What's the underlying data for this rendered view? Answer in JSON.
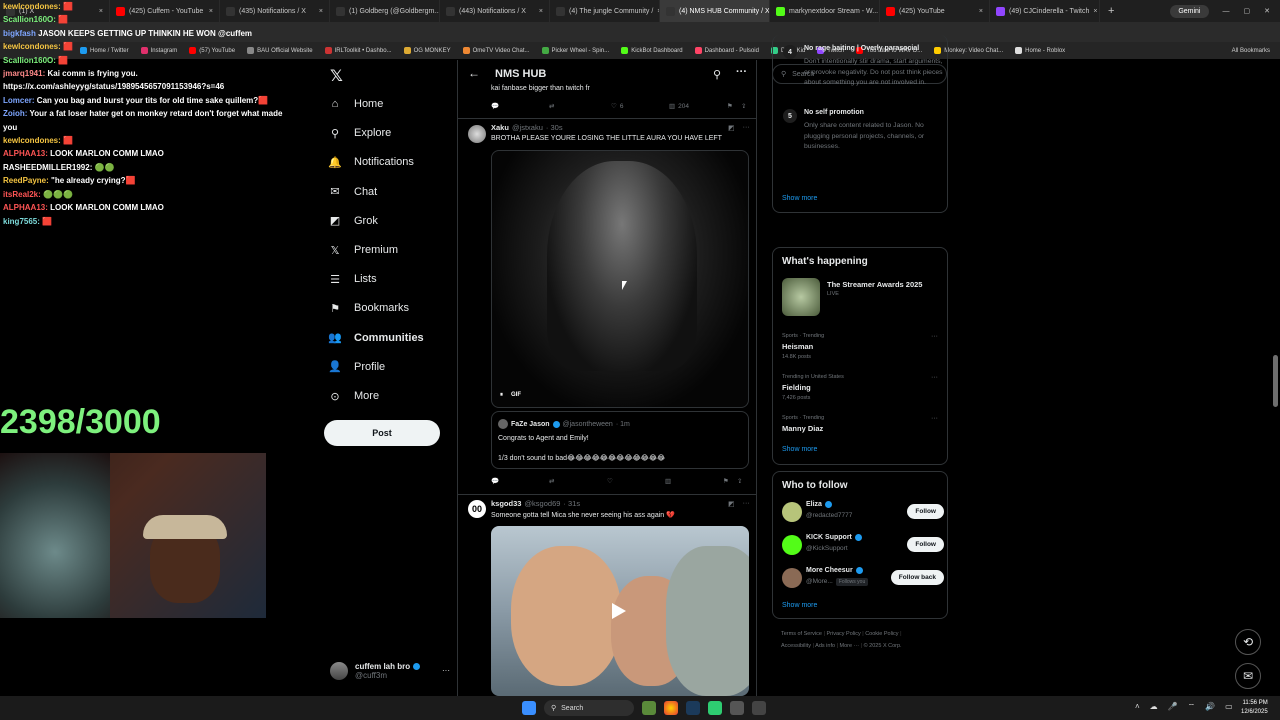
{
  "browser": {
    "tabs": [
      {
        "label": "(1) X",
        "color": "#333333"
      },
      {
        "label": "(425) Cuffem - YouTube",
        "color": "#ff0000"
      },
      {
        "label": "(435) Notifications / X",
        "color": "#333333"
      },
      {
        "label": "(1) Goldberg (@Goldbergm...",
        "color": "#333333"
      },
      {
        "label": "(443) Notifications / X",
        "color": "#333333"
      },
      {
        "label": "(4) The jungle Community /",
        "color": "#333333"
      },
      {
        "label": "(4) NMS HUB Community / X",
        "color": "#333333",
        "active": true
      },
      {
        "label": "markynextdoor Stream - W...",
        "color": "#53fc18"
      },
      {
        "label": "(425) YouTube",
        "color": "#ff0000"
      },
      {
        "label": "(49) CJCinderella - Twitch",
        "color": "#9146ff"
      }
    ],
    "new_tab": "+",
    "gemini": "Gemini",
    "bookmarks": [
      {
        "label": "Home / Twitter",
        "color": "#1d9bf0"
      },
      {
        "label": "Instagram",
        "color": "#e1306c"
      },
      {
        "label": "(57) YouTube",
        "color": "#ff0000"
      },
      {
        "label": "BAU Official Website",
        "color": "#888888"
      },
      {
        "label": "IRLToolkit • Dashbo...",
        "color": "#cc3333"
      },
      {
        "label": "OG MONKEY",
        "color": "#ddaa33"
      },
      {
        "label": "OmeTV Video Chat...",
        "color": "#ee8833"
      },
      {
        "label": "Picker Wheel - Spin...",
        "color": "#44aa44"
      },
      {
        "label": "KickBot Dashboard",
        "color": "#53fc18"
      },
      {
        "label": "Dashboard - Pulsoid",
        "color": "#ff4466"
      },
      {
        "label": "DistroKid",
        "color": "#33cc88"
      },
      {
        "label": "Twitch",
        "color": "#9146ff"
      },
      {
        "label": "YouTube to WAV D...",
        "color": "#ff0000"
      },
      {
        "label": "Monkey: Video Chat...",
        "color": "#ffcc00"
      },
      {
        "label": "Home - Roblox",
        "color": "#dddddd"
      }
    ],
    "all_bookmarks": "All Bookmarks"
  },
  "stream_overlay": {
    "chat": [
      {
        "user": "kewlcondones:",
        "color": "#f5c542",
        "text": "🟥"
      },
      {
        "user": "Scallion160O:",
        "color": "#7df07d",
        "text": "🟥"
      },
      {
        "user": "bigkfash",
        "color": "#7ea6ff",
        "text": "JASON KEEPS GETTING UP THINKIN HE WON @cuffem"
      },
      {
        "user": "kewlcondones:",
        "color": "#f5c542",
        "text": "🟥"
      },
      {
        "user": "Scallion160O:",
        "color": "#7df07d",
        "text": "🟥"
      },
      {
        "user": "jmarq1941:",
        "color": "#ff8a8a",
        "text": "Kai comm is frying you. https://x.com/ashleyyg/status/1989545657091153946?s=46"
      },
      {
        "user": "Lomcer:",
        "color": "#7ea6ff",
        "text": "Can you bag and burst your tits for old time sake quillem?🟥"
      },
      {
        "user": "Zoioh:",
        "color": "#7ea6ff",
        "text": "Your a fat loser hater get on monkey retard don't forget what made you"
      },
      {
        "user": "kewlcondones:",
        "color": "#f5c542",
        "text": "🟥"
      },
      {
        "user": "ALPHAA13:",
        "color": "#ff5555",
        "text": "LOOK MARLON COMM LMAO"
      },
      {
        "user": "RASHEEDMILLER1992:",
        "color": "#ffffff",
        "text": "🟢🟢"
      },
      {
        "user": "ReedPayne:",
        "color": "#f5c542",
        "text": "\"he already crying?🟥"
      },
      {
        "user": "itsReal2k:",
        "color": "#ff5555",
        "text": "🟢🟢🟢"
      },
      {
        "user": "ALPHAA13:",
        "color": "#ff5555",
        "text": "LOOK MARLON COMM LMAO"
      },
      {
        "user": "king7565:",
        "color": "#7ddbdb",
        "text": "🟥"
      }
    ],
    "goal_counter": "2398/3000"
  },
  "nav": {
    "items": [
      {
        "label": "Home",
        "icon": "home-icon",
        "glyph": "⌂"
      },
      {
        "label": "Explore",
        "icon": "search-icon",
        "glyph": "⚲"
      },
      {
        "label": "Notifications",
        "icon": "bell-icon",
        "glyph": "🔔"
      },
      {
        "label": "Chat",
        "icon": "mail-icon",
        "glyph": "✉"
      },
      {
        "label": "Grok",
        "icon": "grok-icon",
        "glyph": "◩"
      },
      {
        "label": "Premium",
        "icon": "x-icon",
        "glyph": "𝕏"
      },
      {
        "label": "Lists",
        "icon": "list-icon",
        "glyph": "☰"
      },
      {
        "label": "Bookmarks",
        "icon": "bookmark-icon",
        "glyph": "⚑"
      },
      {
        "label": "Communities",
        "icon": "communities-icon",
        "glyph": "👥"
      },
      {
        "label": "Profile",
        "icon": "person-icon",
        "glyph": "👤"
      },
      {
        "label": "More",
        "icon": "more-circle-icon",
        "glyph": "⊙"
      }
    ],
    "post_label": "Post",
    "account": {
      "name": "cuffem lah bro",
      "handle": "@cuff3m"
    }
  },
  "feed": {
    "title": "NMS HUB",
    "prev_tweet_text": "kai fanbase bigger than twitch fr",
    "prev_tweet_likes": "6",
    "prev_tweet_views": "204",
    "tweet1": {
      "name": "Xaku",
      "handle": "@jstxaku",
      "time": "· 30s",
      "text": "BROTHA PLEASE YOURE LOSING THE LITTLE AURA YOU HAVE LEFT",
      "gif_label": "GIF",
      "quote": {
        "name": "FaZe Jason",
        "handle": "@jasontheween",
        "time": "· 1m",
        "line1": "Congrats to Agent and Emily!",
        "line2": "1/3 don't sound to bad😂😂😂😂😂😂😂😂😂😂😂😂"
      }
    },
    "tweet2": {
      "name": "ksgod33",
      "handle": "@ksgod69",
      "time": "· 31s",
      "text": "Someone gotta tell Mica she never seeing his ass again 💔"
    }
  },
  "right": {
    "search_placeholder": "Search",
    "rules": [
      {
        "num": "4",
        "title": "No rage baiting | Overly parasocial",
        "desc": "Don't intentionally stir drama, start arguments, or provoke negativity. Do not post think pieces about something you are not involved in."
      },
      {
        "num": "5",
        "title": "No self promotion",
        "desc": "Only share content related to Jason. No plugging personal projects, channels, or businesses."
      }
    ],
    "show_more": "Show more",
    "whats_happening": "What's happening",
    "event": {
      "title": "The Streamer Awards 2025",
      "status": "LIVE"
    },
    "trends": [
      {
        "context": "Sports · Trending",
        "name": "Heisman",
        "posts": "14.8K posts"
      },
      {
        "context": "Trending in United States",
        "name": "Fielding",
        "posts": "7,426 posts"
      },
      {
        "context": "Sports · Trending",
        "name": "Manny Diaz",
        "posts": ""
      }
    ],
    "who_to_follow": "Who to follow",
    "follow": [
      {
        "name": "Eliza",
        "handle": "@redacted7777",
        "button": "Follow",
        "color": "#b7c47a"
      },
      {
        "name": "KICK Support",
        "handle": "@KickSupport",
        "button": "Follow",
        "color": "#53fc18"
      },
      {
        "name": "More Cheesur",
        "handle": "@More...",
        "button": "Follow back",
        "badge": "Follows you",
        "color": "#8a6a55"
      }
    ],
    "footer": [
      "Terms of Service",
      "Privacy Policy",
      "Cookie Policy",
      "Accessibility",
      "Ads info",
      "More ···",
      "© 2025 X Corp."
    ]
  },
  "taskbar": {
    "search": "Search",
    "time": "11:56 PM",
    "date": "12/6/2025"
  }
}
